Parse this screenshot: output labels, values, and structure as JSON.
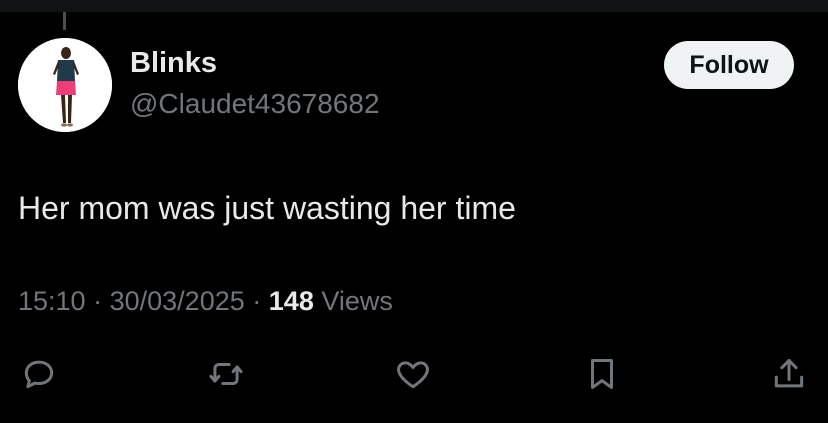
{
  "author": {
    "display_name": "Blinks",
    "handle": "@Claudet43678682",
    "avatar": "avatar-image"
  },
  "follow_button": {
    "label": "Follow"
  },
  "tweet": {
    "text": "Her mom was just wasting her time"
  },
  "meta": {
    "time": "15:10",
    "separator": "·",
    "date": "30/03/2025",
    "views_count": "148",
    "views_label": "Views"
  },
  "actions": [
    {
      "name": "reply",
      "icon": "reply-icon"
    },
    {
      "name": "repost",
      "icon": "repost-icon"
    },
    {
      "name": "like",
      "icon": "heart-icon"
    },
    {
      "name": "bookmark",
      "icon": "bookmark-icon"
    },
    {
      "name": "share",
      "icon": "share-icon"
    }
  ],
  "colors": {
    "background": "#000000",
    "primary_text": "#e7e9ea",
    "secondary_text": "#71767b",
    "button_bg": "#eff3f4",
    "button_text": "#0f1419"
  }
}
